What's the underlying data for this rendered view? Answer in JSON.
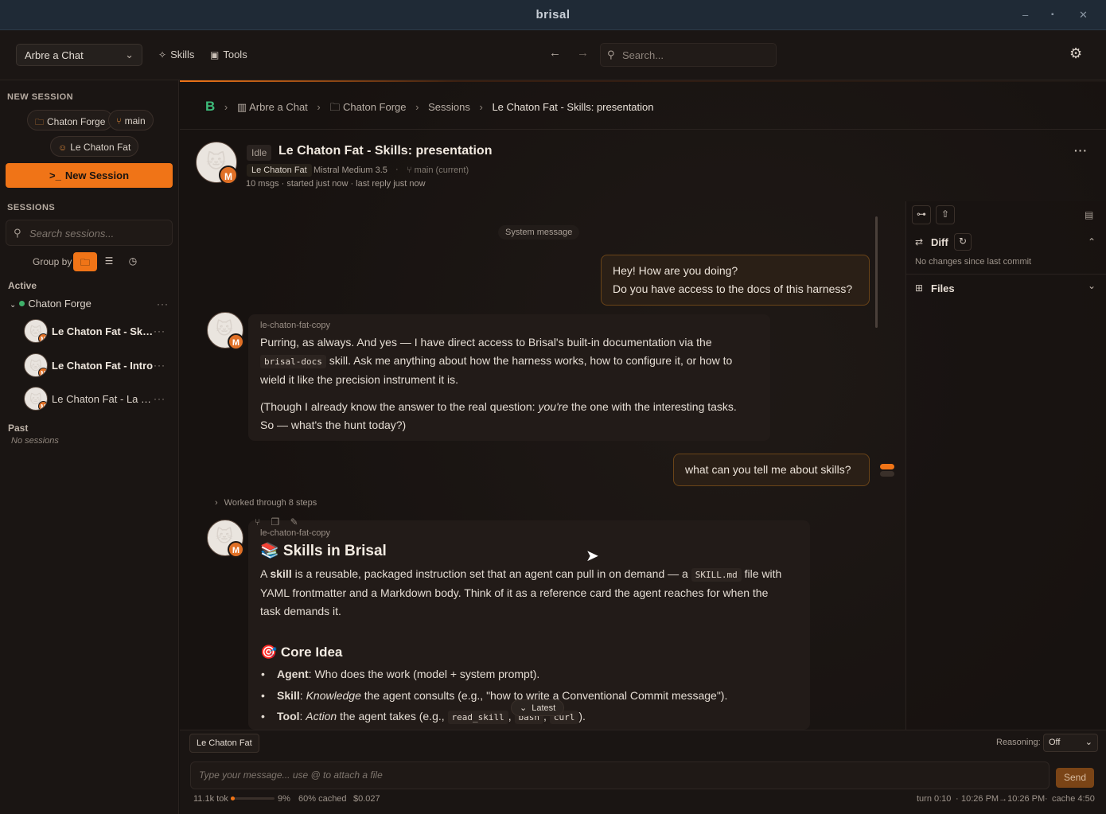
{
  "window": {
    "title": "brisal",
    "controls": [
      "–",
      "▪",
      "✕"
    ]
  },
  "topbar": {
    "project_select": "Arbre a Chat",
    "skills_label": "Skills",
    "tools_label": "Tools",
    "search_placeholder": "Search..."
  },
  "sidebar": {
    "new_session_title": "NEW SESSION",
    "chip_project": "Chaton Forge",
    "chip_branch": "main",
    "chip_agent": "Le Chaton Fat",
    "new_session_button": "New Session",
    "sessions_title": "SESSIONS",
    "search_placeholder": "Search sessions...",
    "group_by_label": "Group by",
    "active_label": "Active",
    "group_name": "Chaton Forge",
    "sessions": [
      {
        "label": "Le Chaton Fat - Skill..."
      },
      {
        "label": "Le Chaton Fat - Intro"
      },
      {
        "label": "Le Chaton Fat - La Fo..."
      }
    ],
    "past_label": "Past",
    "no_sessions": "No sessions"
  },
  "breadcrumb": {
    "logo": "B",
    "items": [
      "Arbre a Chat",
      "Chaton Forge",
      "Sessions",
      "Le Chaton Fat - Skills: presentation"
    ]
  },
  "session": {
    "status": "Idle",
    "title": "Le Chaton Fat - Skills: presentation",
    "agent": "Le Chaton Fat",
    "model": "Mistral Medium 3.5",
    "branch": "main (current)",
    "meta": "10 msgs · started just now · last reply just now",
    "avatar_badge": "M"
  },
  "chat": {
    "system_message": "System message",
    "user1_line1": "Hey! How are you doing?",
    "user1_line2": "Do you have access to the docs of this harness?",
    "sender": "le-chaton-fat-copy",
    "a1_p1a": "Purring, as always. And yes — I have direct access to Brisal's built-in documentation via the",
    "a1_code": "brisal-docs",
    "a1_p1b": "skill. Ask me anything about how the harness works, how to configure it, or how to",
    "a1_p1c": "wield it like the precision instrument it is.",
    "a1_p2a": "(Though I already know the answer to the real question:",
    "a1_p2_em": "you're",
    "a1_p2b": "the one with the interesting tasks.",
    "a1_p2c": "So — what's the hunt today?)",
    "user2": "what can you tell me about skills?",
    "worked": "Worked through 8 steps",
    "a2_heading": "📚 Skills in Brisal",
    "a2_p1_pre": "A",
    "a2_p1_bold": "skill",
    "a2_p1_mid": "is a reusable, packaged instruction set that an agent can pull in on demand — a",
    "a2_p1_code": "SKILL.md",
    "a2_p1_post": "file with",
    "a2_p1_l2": "YAML frontmatter and a Markdown body. Think of it as a reference card the agent reaches for when the",
    "a2_p1_l3": "task demands it.",
    "a2_h3": "🎯 Core Idea",
    "li1_bold": "Agent",
    "li1_text": ": Who does the work (model + system prompt).",
    "li2_bold": "Skill",
    "li2_em": "Knowledge",
    "li2_text": "the agent consults (e.g., \"how to write a Conventional Commit message\").",
    "li3_bold": "Tool",
    "li3_em": "Action",
    "li3_text": "the agent takes (e.g.,",
    "li3_code1": "read_skill",
    "li3_code2": "bash",
    "li3_code3": "curl",
    "latest": "Latest"
  },
  "right_panel": {
    "diff_label": "Diff",
    "diff_sub": "No changes since last commit",
    "files_label": "Files"
  },
  "composer": {
    "agent_tab": "Le Chaton Fat",
    "reasoning_label": "Reasoning:",
    "reasoning_value": "Off",
    "placeholder": "Type your message... use @ to attach a file",
    "send": "Send"
  },
  "stats": {
    "tokens": "11.1k tok",
    "context_percent": "9%",
    "context_fill": 0.09,
    "cached": "60% cached",
    "cost": "$0.027",
    "turn": "turn 0:10",
    "time_range": "10:26 PM→10:26 PM",
    "cache": "cache 4:50"
  },
  "colors": {
    "accent": "#f07417",
    "status_green": "#3fb06a",
    "logo_green": "#3dbb7a"
  }
}
